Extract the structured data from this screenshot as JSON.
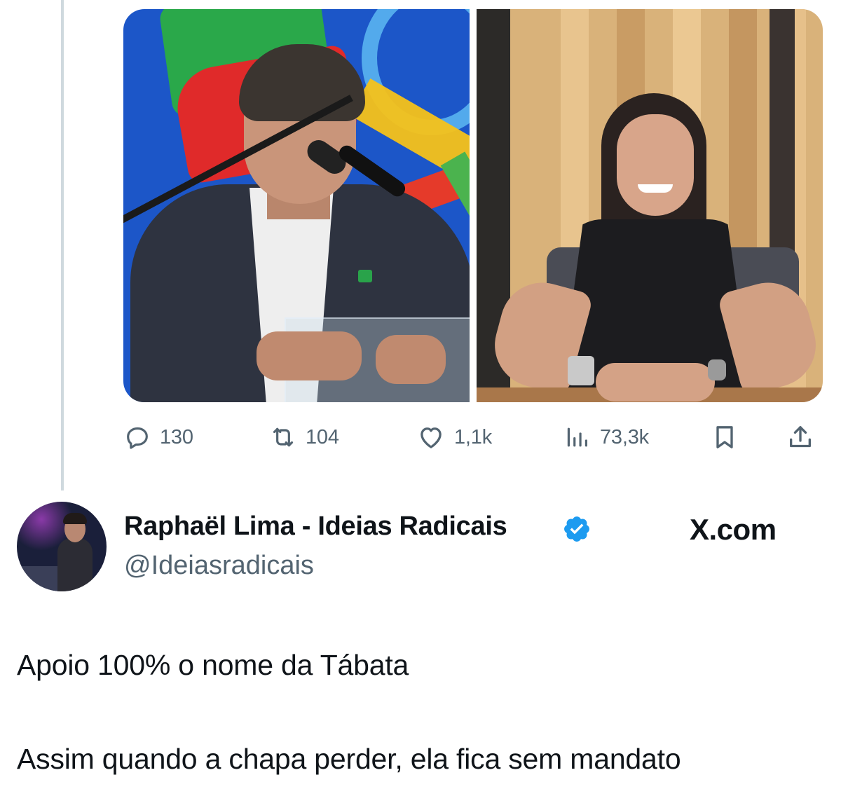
{
  "tweet_above": {
    "media": [
      {
        "icon": "photo-man-speaking-at-podium"
      },
      {
        "icon": "photo-woman-seated-at-desk"
      }
    ],
    "actions": {
      "replies": "130",
      "retweets": "104",
      "likes": "1,1k",
      "views": "73,3k",
      "icons": [
        "reply-icon",
        "retweet-icon",
        "like-icon",
        "views-icon",
        "bookmark-icon",
        "share-icon"
      ]
    }
  },
  "author": {
    "name": "Raphaël Lima - Ideias Radicais",
    "handle": "@Ideiasradicais",
    "verified": true,
    "verified_color": "#1d9bf0"
  },
  "brand": "X.com",
  "tweet": {
    "lines": [
      "Apoio 100% o nome da Tábata",
      "Assim quando a chapa perder, ela fica sem mandato"
    ]
  },
  "colors": {
    "text_primary": "#0f1419",
    "text_secondary": "#536471",
    "thread_line": "#cfd9de",
    "background": "#ffffff"
  }
}
